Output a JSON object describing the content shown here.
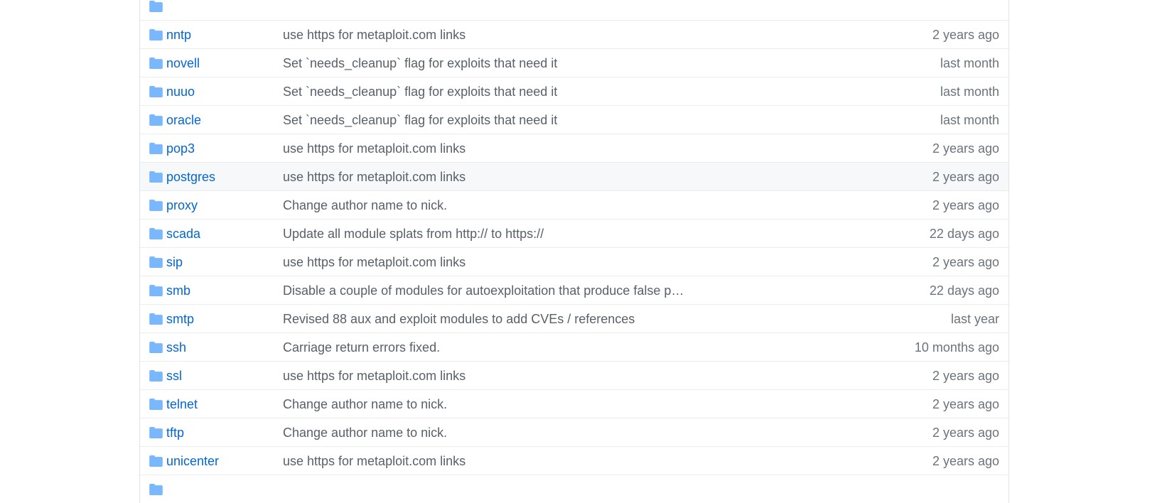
{
  "colors": {
    "link": "#0366d6",
    "message": "#586069",
    "age": "#6a737d",
    "folder_icon": "#79b8ff",
    "row_border": "#eaecef",
    "hover_row": "#f6f8fa"
  },
  "icon": "folder-icon",
  "rows": [
    {
      "name": "",
      "message": "",
      "age": ""
    },
    {
      "name": "nntp",
      "message": "use https for metaploit.com links",
      "age": "2 years ago"
    },
    {
      "name": "novell",
      "message": "Set `needs_cleanup` flag for exploits that need it",
      "age": "last month"
    },
    {
      "name": "nuuo",
      "message": "Set `needs_cleanup` flag for exploits that need it",
      "age": "last month"
    },
    {
      "name": "oracle",
      "message": "Set `needs_cleanup` flag for exploits that need it",
      "age": "last month"
    },
    {
      "name": "pop3",
      "message": "use https for metaploit.com links",
      "age": "2 years ago"
    },
    {
      "name": "postgres",
      "message": "use https for metaploit.com links",
      "age": "2 years ago"
    },
    {
      "name": "proxy",
      "message": "Change author name to nick.",
      "age": "2 years ago"
    },
    {
      "name": "scada",
      "message": "Update all module splats from http:// to https://",
      "age": "22 days ago"
    },
    {
      "name": "sip",
      "message": "use https for metaploit.com links",
      "age": "2 years ago"
    },
    {
      "name": "smb",
      "message": "Disable a couple of modules for autoexploitation that produce false p…",
      "age": "22 days ago"
    },
    {
      "name": "smtp",
      "message": "Revised 88 aux and exploit modules to add CVEs / references",
      "age": "last year"
    },
    {
      "name": "ssh",
      "message": "Carriage return errors fixed.",
      "age": "10 months ago"
    },
    {
      "name": "ssl",
      "message": "use https for metaploit.com links",
      "age": "2 years ago"
    },
    {
      "name": "telnet",
      "message": "Change author name to nick.",
      "age": "2 years ago"
    },
    {
      "name": "tftp",
      "message": "Change author name to nick.",
      "age": "2 years ago"
    },
    {
      "name": "unicenter",
      "message": "use https for metaploit.com links",
      "age": "2 years ago"
    },
    {
      "name": "",
      "message": "",
      "age": ""
    }
  ]
}
